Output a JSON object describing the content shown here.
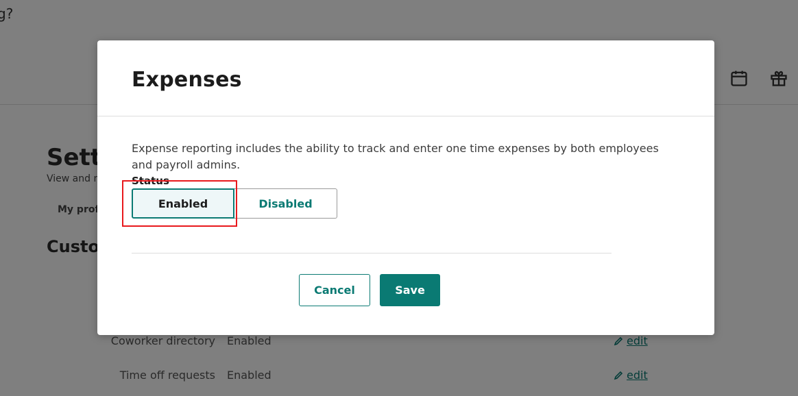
{
  "background": {
    "question_fragment": "g?",
    "settings_title": "Setti",
    "settings_subtitle": "View and m",
    "tab_my_profile": "My profi",
    "section_title": "Custor",
    "rows": [
      {
        "label": "Coworker directory",
        "value": "Enabled",
        "edit": "edit"
      },
      {
        "label": "Time off requests",
        "value": "Enabled",
        "edit": "edit"
      }
    ]
  },
  "modal": {
    "title": "Expenses",
    "description": "Expense reporting includes the ability to track and enter one time expenses by both employees and payroll admins.",
    "status_label": "Status",
    "status_options": [
      "Enabled",
      "Disabled"
    ],
    "selected_status": "Enabled",
    "cancel_label": "Cancel",
    "save_label": "Save"
  },
  "colors": {
    "accent": "#0a7a73",
    "highlight": "#e8181c",
    "overlay": "rgba(0,0,0,0.5)"
  },
  "icons": [
    "calendar-icon",
    "gift-icon",
    "pencil-icon"
  ]
}
